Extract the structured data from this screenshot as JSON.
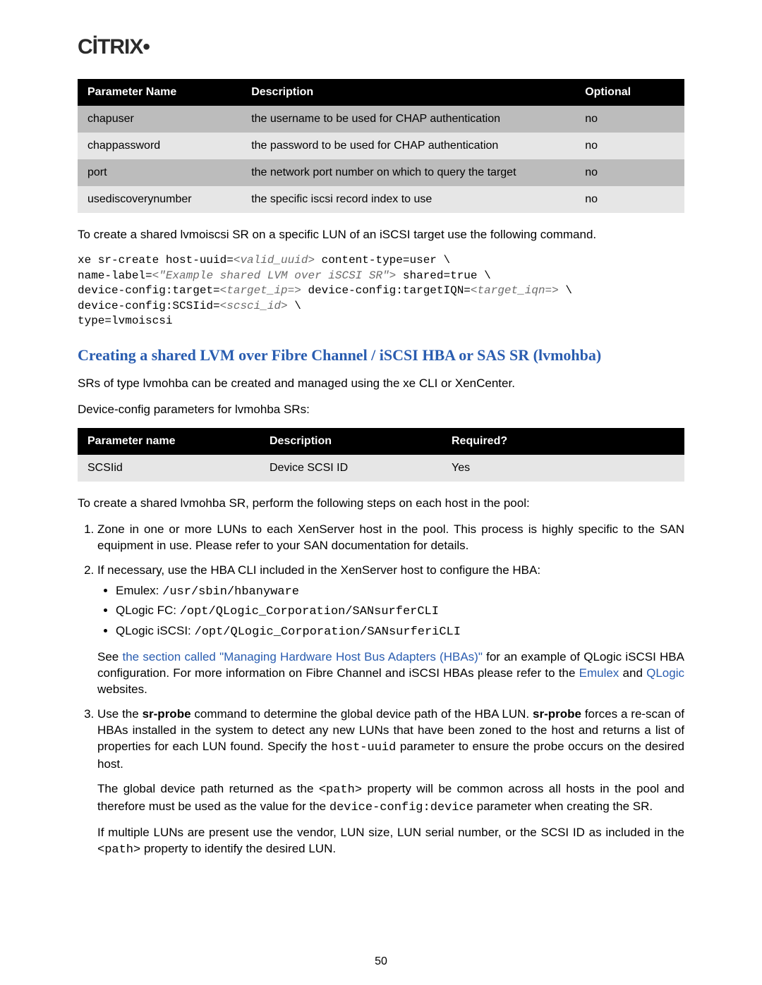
{
  "logo_text": "CİTRIX",
  "table1": {
    "headers": [
      "Parameter Name",
      "Description",
      "Optional"
    ],
    "rows": [
      {
        "c0": "chapuser",
        "c1": "the username to be used for CHAP authentication",
        "c2": "no"
      },
      {
        "c0": "chappassword",
        "c1": "the password to be used for CHAP authentication",
        "c2": "no"
      },
      {
        "c0": "port",
        "c1": "the network port number on which to query the target",
        "c2": "no"
      },
      {
        "c0": "usediscoverynumber",
        "c1": "the specific iscsi record index to use",
        "c2": "no"
      }
    ]
  },
  "para1": "To create a shared lvmoiscsi SR on a specific LUN of an iSCSI target use the following command.",
  "code1": {
    "l1a": "xe sr-create host-uuid=",
    "l1v": "<valid_uuid>",
    "l1b": " content-type=user \\",
    "l2a": "name-label=",
    "l2v": "<\"Example shared LVM over iSCSI SR\">",
    "l2b": " shared=true \\",
    "l3a": "device-config:target=",
    "l3v": "<target_ip=>",
    "l3b": " device-config:targetIQN=",
    "l3v2": "<target_iqn=>",
    "l3c": " \\",
    "l4a": "device-config:SCSIid=",
    "l4v": "<scsci_id>",
    "l4b": " \\",
    "l5": "type=lvmoiscsi"
  },
  "heading2": "Creating a shared LVM over Fibre Channel / iSCSI HBA or SAS SR (lvmohba)",
  "para2": "SRs of type lvmohba can be created and managed using the xe CLI or XenCenter.",
  "para3": "Device-config parameters for lvmohba SRs:",
  "table2": {
    "headers": [
      "Parameter name",
      "Description",
      "Required?"
    ],
    "rows": [
      {
        "c0": "SCSIid",
        "c1": "Device SCSI ID",
        "c2": "Yes"
      }
    ]
  },
  "para4": "To create a shared lvmohba SR, perform the following steps on each host in the pool:",
  "list": {
    "i1": "Zone in one or more LUNs to each XenServer host in the pool. This process is highly specific to the SAN equipment in use. Please refer to your SAN documentation for details.",
    "i2": "If necessary, use the HBA CLI included in the XenServer host to configure the HBA:",
    "sub": {
      "a_label": "Emulex: ",
      "a_code": "/usr/sbin/hbanyware",
      "b_label": "QLogic FC: ",
      "b_code": "/opt/QLogic_Corporation/SANsurferCLI",
      "c_label": "QLogic iSCSI: ",
      "c_code": "/opt/QLogic_Corporation/SANsurferiCLI"
    },
    "i2_p1a": "See ",
    "i2_link1": "the section called \"Managing Hardware Host Bus Adapters (HBAs)\"",
    "i2_p1b": " for an example of QLogic iSCSI HBA configuration. For more information on Fibre Channel and iSCSI HBAs please refer to the ",
    "i2_link2": "Emulex",
    "i2_p1c": " and ",
    "i2_link3": "QLogic",
    "i2_p1d": " websites.",
    "i3a": "Use the ",
    "i3b": "sr-probe",
    "i3c": " command to determine the global device path of the HBA LUN. ",
    "i3d": "sr-probe",
    "i3e": " forces a re-scan of HBAs installed in the system to detect any new LUNs that have been zoned to the host and returns a list of properties for each LUN found. Specify the ",
    "i3f": "host-uuid",
    "i3g": " parameter to ensure the probe occurs on the desired host.",
    "i3_p2a": "The global device path returned as the ",
    "i3_p2b": "<path>",
    "i3_p2c": " property will be common across all hosts in the pool and therefore must be used as the value for the ",
    "i3_p2d": "device-config:device",
    "i3_p2e": " parameter when creating the SR.",
    "i3_p3a": "If multiple LUNs are present use the vendor, LUN size, LUN serial number, or the SCSI ID as included in the ",
    "i3_p3b": "<path>",
    "i3_p3c": " property to identify the desired LUN."
  },
  "page_number": "50"
}
